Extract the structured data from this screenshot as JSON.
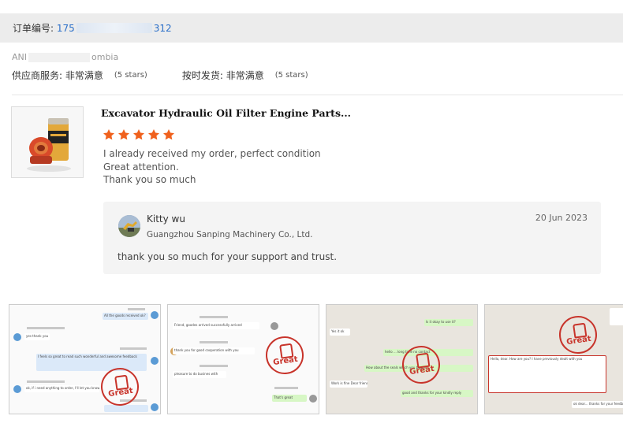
{
  "order": {
    "label": "订单编号:",
    "number_prefix": "175",
    "number_suffix": "312"
  },
  "buyer": {
    "prefix": "ANI",
    "suffix": "ombia"
  },
  "ratings": {
    "supplier_label": "供应商服务:",
    "supplier_value": "非常满意",
    "supplier_stars": "(5 stars)",
    "shipping_label": "按时发货:",
    "shipping_value": "非常满意",
    "shipping_stars": "(5 stars)"
  },
  "product": {
    "title": "Excavator Hydraulic Oil Filter Engine Parts...",
    "star_rating": 5,
    "star_color": "#f0611d"
  },
  "review": {
    "lines": [
      "I already received my order, perfect condition",
      "Great attention.",
      "Thank you so much"
    ]
  },
  "reply": {
    "name": "Kitty wu",
    "company": "Guangzhou Sanping Machinery Co., Ltd.",
    "date": "20 Jun 2023",
    "text": "thank you so much for your support and trust."
  },
  "screenshots": {
    "stamp_text": "Great",
    "s1": {
      "m1": "All the goods received ok?",
      "m2": "yes thank you",
      "m3": "I feels so great to read such wonderful and awesome feedback",
      "m4": "ok, if i need anything to order, I'll let you know."
    },
    "s2": {
      "m1": "Friend, goodes arrived successfully arrived",
      "m2": "thank you for good cooperation with you",
      "m3": "pleasure to do busines with",
      "m4": "That's great"
    },
    "s3": {
      "m1": "Is it okay to use it?",
      "m2": "Yes it ok",
      "m3": "hello ... long time no contact",
      "m4": "How about the seals which you bought",
      "m5": "Work is fine Dear friend",
      "m6": "good and thanks for your kindly reply"
    },
    "s4": {
      "m1": "Hello, dear. How are you? I have previously dealt with you",
      "m2": "ok dear... thanks for your feedback"
    }
  }
}
